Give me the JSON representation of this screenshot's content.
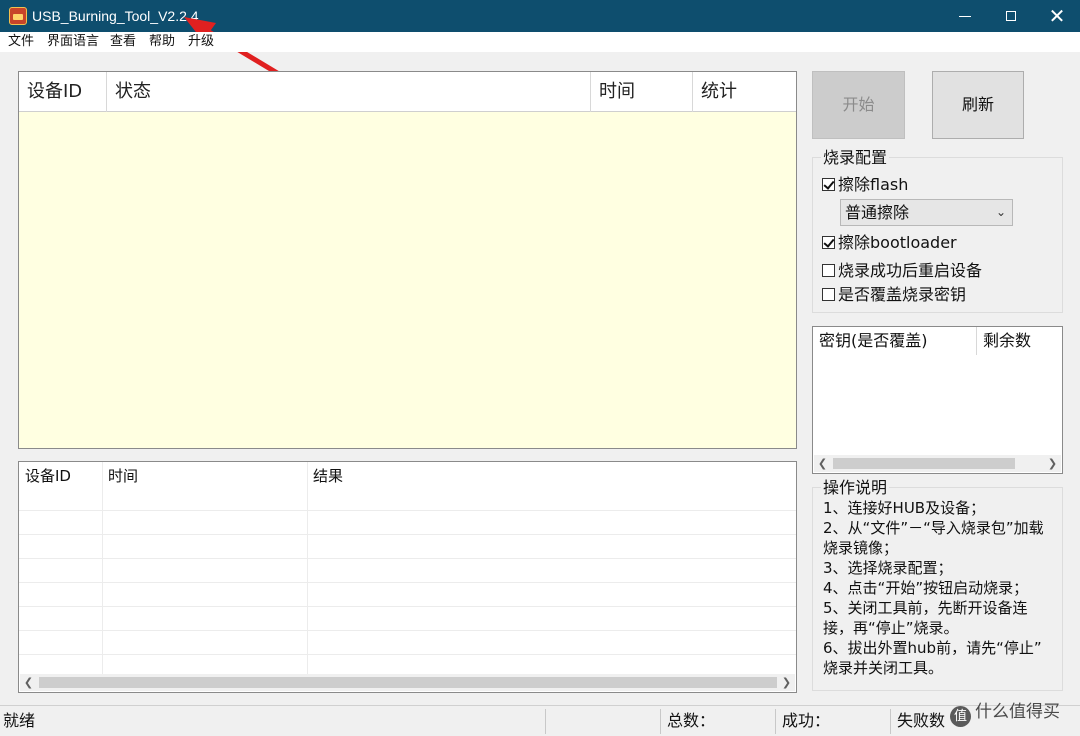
{
  "window": {
    "title": "USB_Burning_Tool_V2.2.4",
    "minimize": "",
    "maximize": "",
    "close": "✕"
  },
  "menu": [
    "文件",
    "界面语言",
    "查看",
    "帮助",
    "升级"
  ],
  "device_table": {
    "columns": [
      "设备ID",
      "状态",
      "时间",
      "统计"
    ]
  },
  "result_list": {
    "columns": [
      "设备ID",
      "时间",
      "结果"
    ]
  },
  "buttons": {
    "start": "开始",
    "refresh": "刷新"
  },
  "burn_config": {
    "title": "烧录配置",
    "erase_flash": {
      "label": "擦除flash",
      "checked": true
    },
    "erase_mode": "普通擦除",
    "erase_bootloader": {
      "label": "擦除bootloader",
      "checked": true
    },
    "reboot_after": {
      "label": "烧录成功后重启设备",
      "checked": false
    },
    "overwrite_key": {
      "label": "是否覆盖烧录密钥",
      "checked": false
    }
  },
  "key_list": {
    "columns": [
      "密钥(是否覆盖)",
      "剩余数"
    ]
  },
  "instructions": {
    "title": "操作说明",
    "lines": [
      "1、连接好HUB及设备；",
      "2、从“文件”－“导入烧录包”加载",
      "烧录镜像；",
      "3、选择烧录配置；",
      "4、点击“开始”按钮启动烧录；",
      "5、关闭工具前，先断开设备连",
      "接，再“停止”烧录。",
      "6、拔出外置hub前，请先“停止”",
      "烧录并关闭工具。"
    ]
  },
  "status_bar": {
    "status": "就绪",
    "total": "总数：",
    "success": "成功：",
    "fail": "失败数"
  },
  "watermark": {
    "badge": "值",
    "text": "什么值得买"
  }
}
